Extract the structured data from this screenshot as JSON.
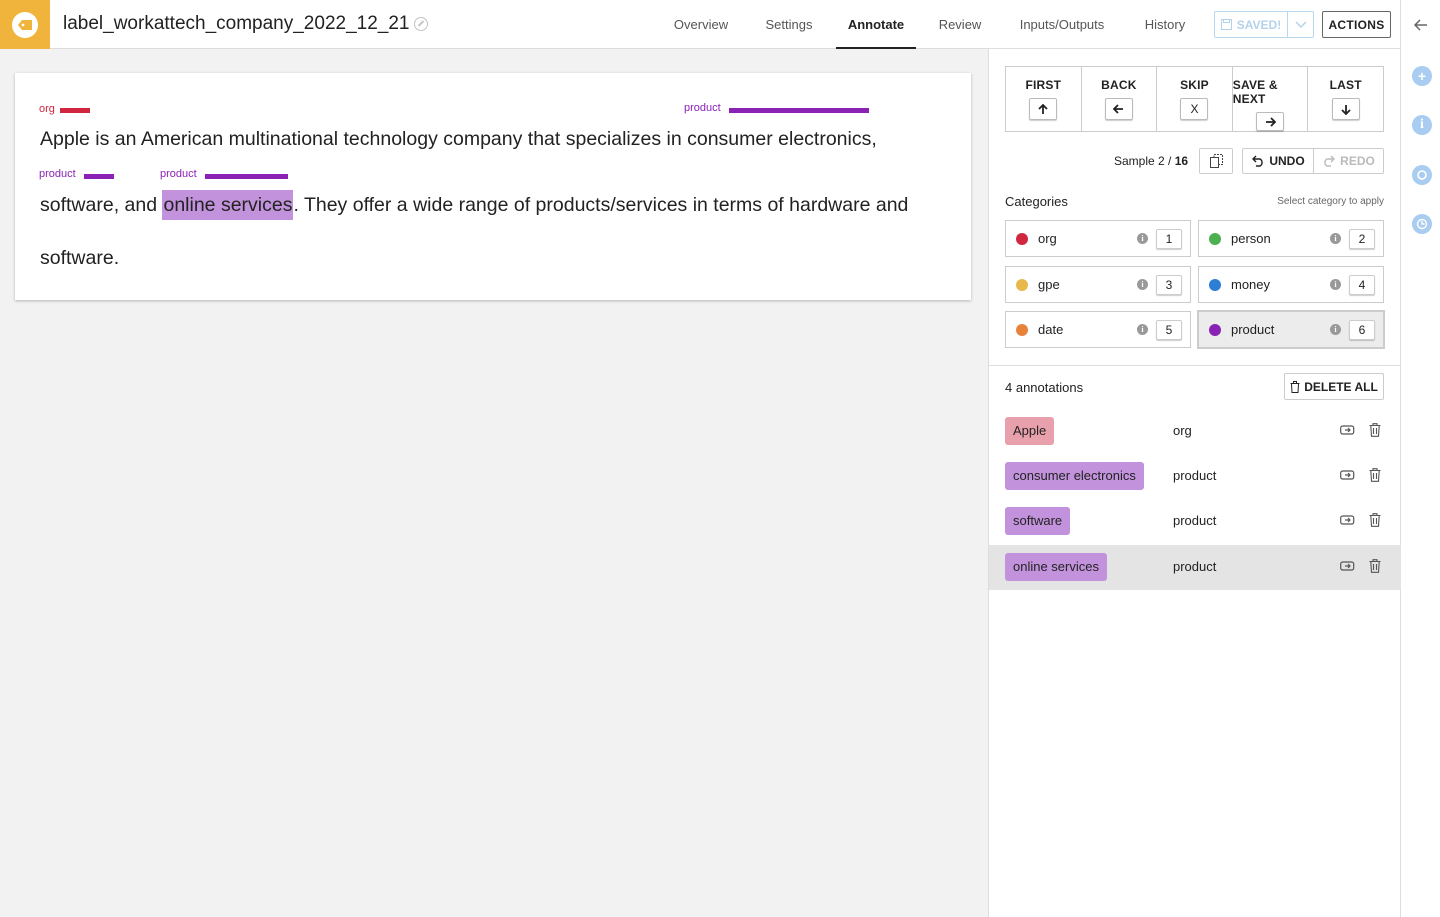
{
  "app": {
    "title": "label_workattech_company_2022_12_21"
  },
  "tabs": [
    {
      "label": "Overview"
    },
    {
      "label": "Settings"
    },
    {
      "label": "Annotate"
    },
    {
      "label": "Review"
    },
    {
      "label": "Inputs/Outputs"
    },
    {
      "label": "History"
    }
  ],
  "active_tab": "Annotate",
  "header": {
    "saved_label": "SAVED!",
    "actions_label": "ACTIONS"
  },
  "document": {
    "lines": [
      {
        "text": "Apple is an American multinational technology company that specializes in consumer electronics,"
      },
      {
        "before": "software, and ",
        "highlight": "online services",
        "after": ". They offer a wide range of products/services in terms of hardware and"
      },
      {
        "text": "software."
      }
    ],
    "labels": [
      {
        "name": "org",
        "color": "#d0263f"
      },
      {
        "name": "product",
        "color": "#8a22b5"
      },
      {
        "name": "product",
        "color": "#8a22b5"
      },
      {
        "name": "product",
        "color": "#8a22b5"
      }
    ]
  },
  "navigation": [
    {
      "label": "FIRST",
      "key": "↑"
    },
    {
      "label": "BACK",
      "key": "←"
    },
    {
      "label": "SKIP",
      "key": "X"
    },
    {
      "label": "SAVE & NEXT",
      "key": "→"
    },
    {
      "label": "LAST",
      "key": "↓"
    }
  ],
  "sample": {
    "prefix": "Sample 2 / ",
    "total": "16"
  },
  "history": {
    "undo_label": "UNDO",
    "redo_label": "REDO"
  },
  "categories_section": {
    "title": "Categories",
    "hint": "Select category to apply"
  },
  "categories": [
    {
      "name": "org",
      "key": "1",
      "color": "#d0263f"
    },
    {
      "name": "person",
      "key": "2",
      "color": "#4caf50"
    },
    {
      "name": "gpe",
      "key": "3",
      "color": "#e8b84a"
    },
    {
      "name": "money",
      "key": "4",
      "color": "#2d7fd3"
    },
    {
      "name": "date",
      "key": "5",
      "color": "#e8823a"
    },
    {
      "name": "product",
      "key": "6",
      "color": "#8a22b5"
    }
  ],
  "selected_category": "product",
  "annotations_section": {
    "count_label": "4 annotations",
    "delete_all_label": "DELETE ALL"
  },
  "annotations": [
    {
      "text": "Apple",
      "category": "org",
      "color": "#e8a0ac"
    },
    {
      "text": "consumer electronics",
      "category": "product",
      "color": "#c293dc"
    },
    {
      "text": "software",
      "category": "product",
      "color": "#c293dc"
    },
    {
      "text": "online services",
      "category": "product",
      "color": "#c293dc"
    }
  ],
  "selected_annotation_index": 3
}
